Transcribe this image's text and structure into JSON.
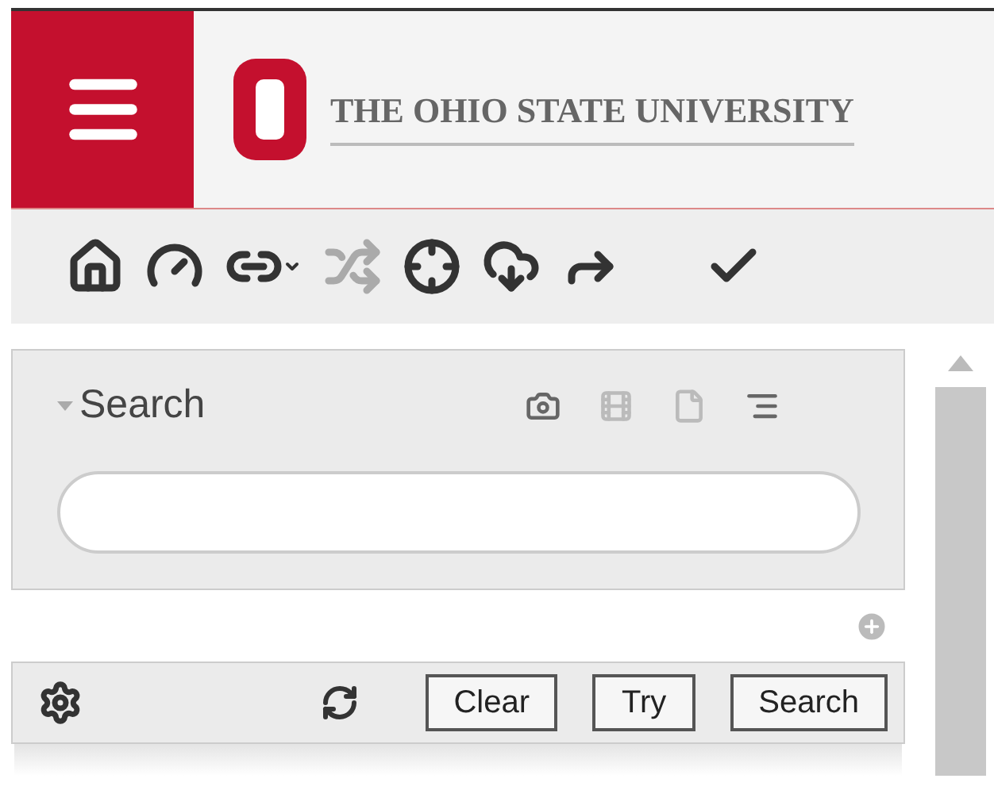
{
  "header": {
    "title": "THE OHIO STATE UNIVERSITY"
  },
  "toolbar": [
    {
      "kind": "home",
      "disabled": false
    },
    {
      "kind": "dashboard",
      "disabled": false
    },
    {
      "kind": "link",
      "disabled": false
    },
    {
      "kind": "shuffle",
      "disabled": true
    },
    {
      "kind": "target",
      "disabled": false
    },
    {
      "kind": "download",
      "disabled": false
    },
    {
      "kind": "forward",
      "disabled": false
    },
    {
      "kind": "check",
      "disabled": false
    }
  ],
  "search_panel": {
    "title": "Search",
    "expanded": true,
    "tools": [
      {
        "kind": "camera",
        "disabled": false
      },
      {
        "kind": "film",
        "disabled": true
      },
      {
        "kind": "file",
        "disabled": true
      },
      {
        "kind": "lines",
        "disabled": false
      }
    ],
    "buttons": [
      "Clear",
      "Try",
      "Search"
    ]
  }
}
